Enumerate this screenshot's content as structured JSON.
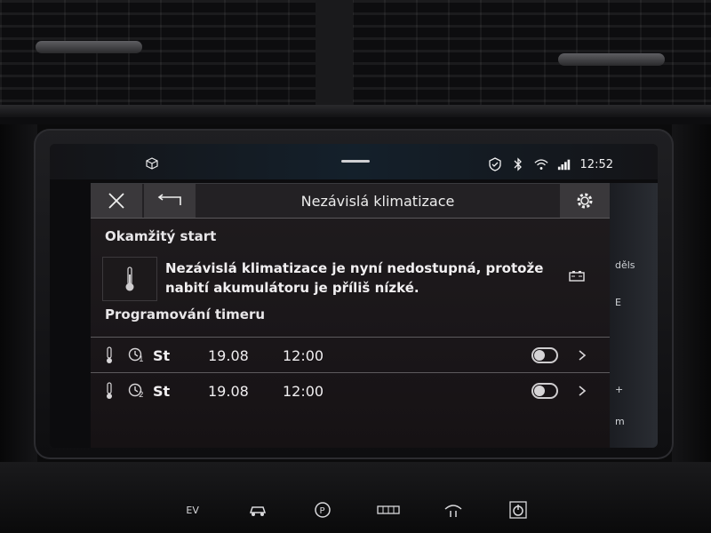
{
  "status_bar": {
    "time": "12:52",
    "icons": [
      "cube-icon",
      "shield-check-icon",
      "bluetooth-icon",
      "wifi-icon",
      "signal-icon"
    ]
  },
  "dialog": {
    "title": "Nezávislá klimatizace",
    "close_icon": "close-icon",
    "back_icon": "back-arrow-icon",
    "settings_icon": "gear-icon",
    "instant_start": {
      "heading": "Okamžitý start",
      "message": "Nezávislá klimatizace je nyní nedostupná, protože nabití akumulátoru je příliš nízké."
    },
    "timer": {
      "heading": "Programování timeru",
      "rows": [
        {
          "clock_index": "1",
          "day": "St",
          "date": "19.08",
          "time": "12:00",
          "enabled": false
        },
        {
          "clock_index": "2",
          "day": "St",
          "date": "19.08",
          "time": "12:00",
          "enabled": false
        }
      ]
    }
  },
  "map_peek": {
    "labels": [
      "děls",
      "E",
      "+",
      "m"
    ]
  },
  "bottom_controls": {
    "ev_label": "EV"
  }
}
